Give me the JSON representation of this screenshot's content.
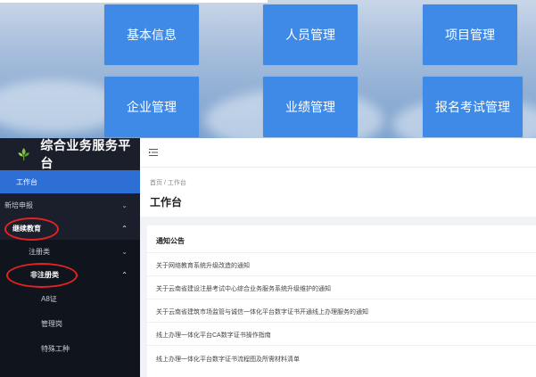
{
  "banner": {
    "tiles": [
      {
        "label": "基本信息"
      },
      {
        "label": "人员管理"
      },
      {
        "label": "项目管理"
      },
      {
        "label": "企业管理"
      },
      {
        "label": "业绩管理"
      },
      {
        "label": "报名考试管理"
      }
    ],
    "tile_color": "#3f8ae6"
  },
  "sidebar": {
    "title": "综合业务服务平台",
    "logo_icon": "leaf-logo-icon",
    "items": [
      {
        "label": "工作台",
        "state": "active"
      },
      {
        "label": "新培申报",
        "chevron": "⌄"
      },
      {
        "label": "继续教育",
        "chevron": "⌃",
        "highlighted": true
      },
      {
        "label": "注册类",
        "chevron": "⌄"
      },
      {
        "label": "非注册类",
        "chevron": "⌃",
        "highlighted": true
      },
      {
        "label": "A8证"
      },
      {
        "label": "管理岗"
      },
      {
        "label": "特殊工种"
      }
    ],
    "active_color": "#2e6fd6",
    "highlight_color": "#e52222"
  },
  "main": {
    "menu_icon": "menu-fold-icon",
    "breadcrumb": "首页 / 工作台",
    "page_title": "工作台",
    "card_title": "通知公告",
    "notices": [
      "关于网络教育系统升级改造的通知",
      "关于云南省建设注册考试中心综合业务服务系统升级维护的通知",
      "关于云南省建筑市场监管与诚信一体化平台数字证书开通线上办理服务的通知",
      "线上办理一体化平台CA数字证书操作指南",
      "线上办理一体化平台数字证书流程图及所需材料清单"
    ]
  }
}
